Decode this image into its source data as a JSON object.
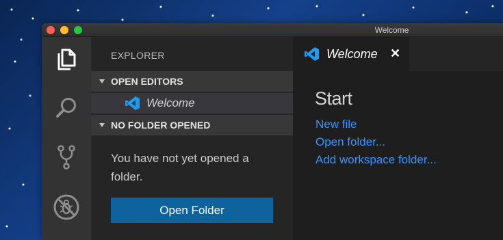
{
  "window": {
    "title": "Welcome"
  },
  "activity_bar": {
    "items": [
      {
        "icon": "files-icon",
        "active": true
      },
      {
        "icon": "search-icon",
        "active": false
      },
      {
        "icon": "source-control-icon",
        "active": false
      },
      {
        "icon": "debug-icon",
        "active": false
      }
    ]
  },
  "sidebar": {
    "title": "EXPLORER",
    "open_editors": {
      "header": "OPEN EDITORS",
      "items": [
        {
          "icon": "vscode-logo-icon",
          "label": "Welcome"
        }
      ]
    },
    "no_folder": {
      "header": "NO FOLDER OPENED",
      "message": "You have not yet opened a folder.",
      "button_label": "Open Folder"
    }
  },
  "editor": {
    "tabs": [
      {
        "icon": "vscode-logo-icon",
        "label": "Welcome",
        "close": "✕"
      }
    ],
    "welcome": {
      "start_heading": "Start",
      "links": [
        "New file",
        "Open folder...",
        "Add workspace folder..."
      ]
    }
  },
  "colors": {
    "accent_blue": "#0e639c",
    "link_blue": "#3794ff",
    "vscode_logo_blue": "#1f9cf0",
    "activity_bar": "#333333",
    "sidebar": "#252526",
    "editor": "#1e1e1e"
  }
}
